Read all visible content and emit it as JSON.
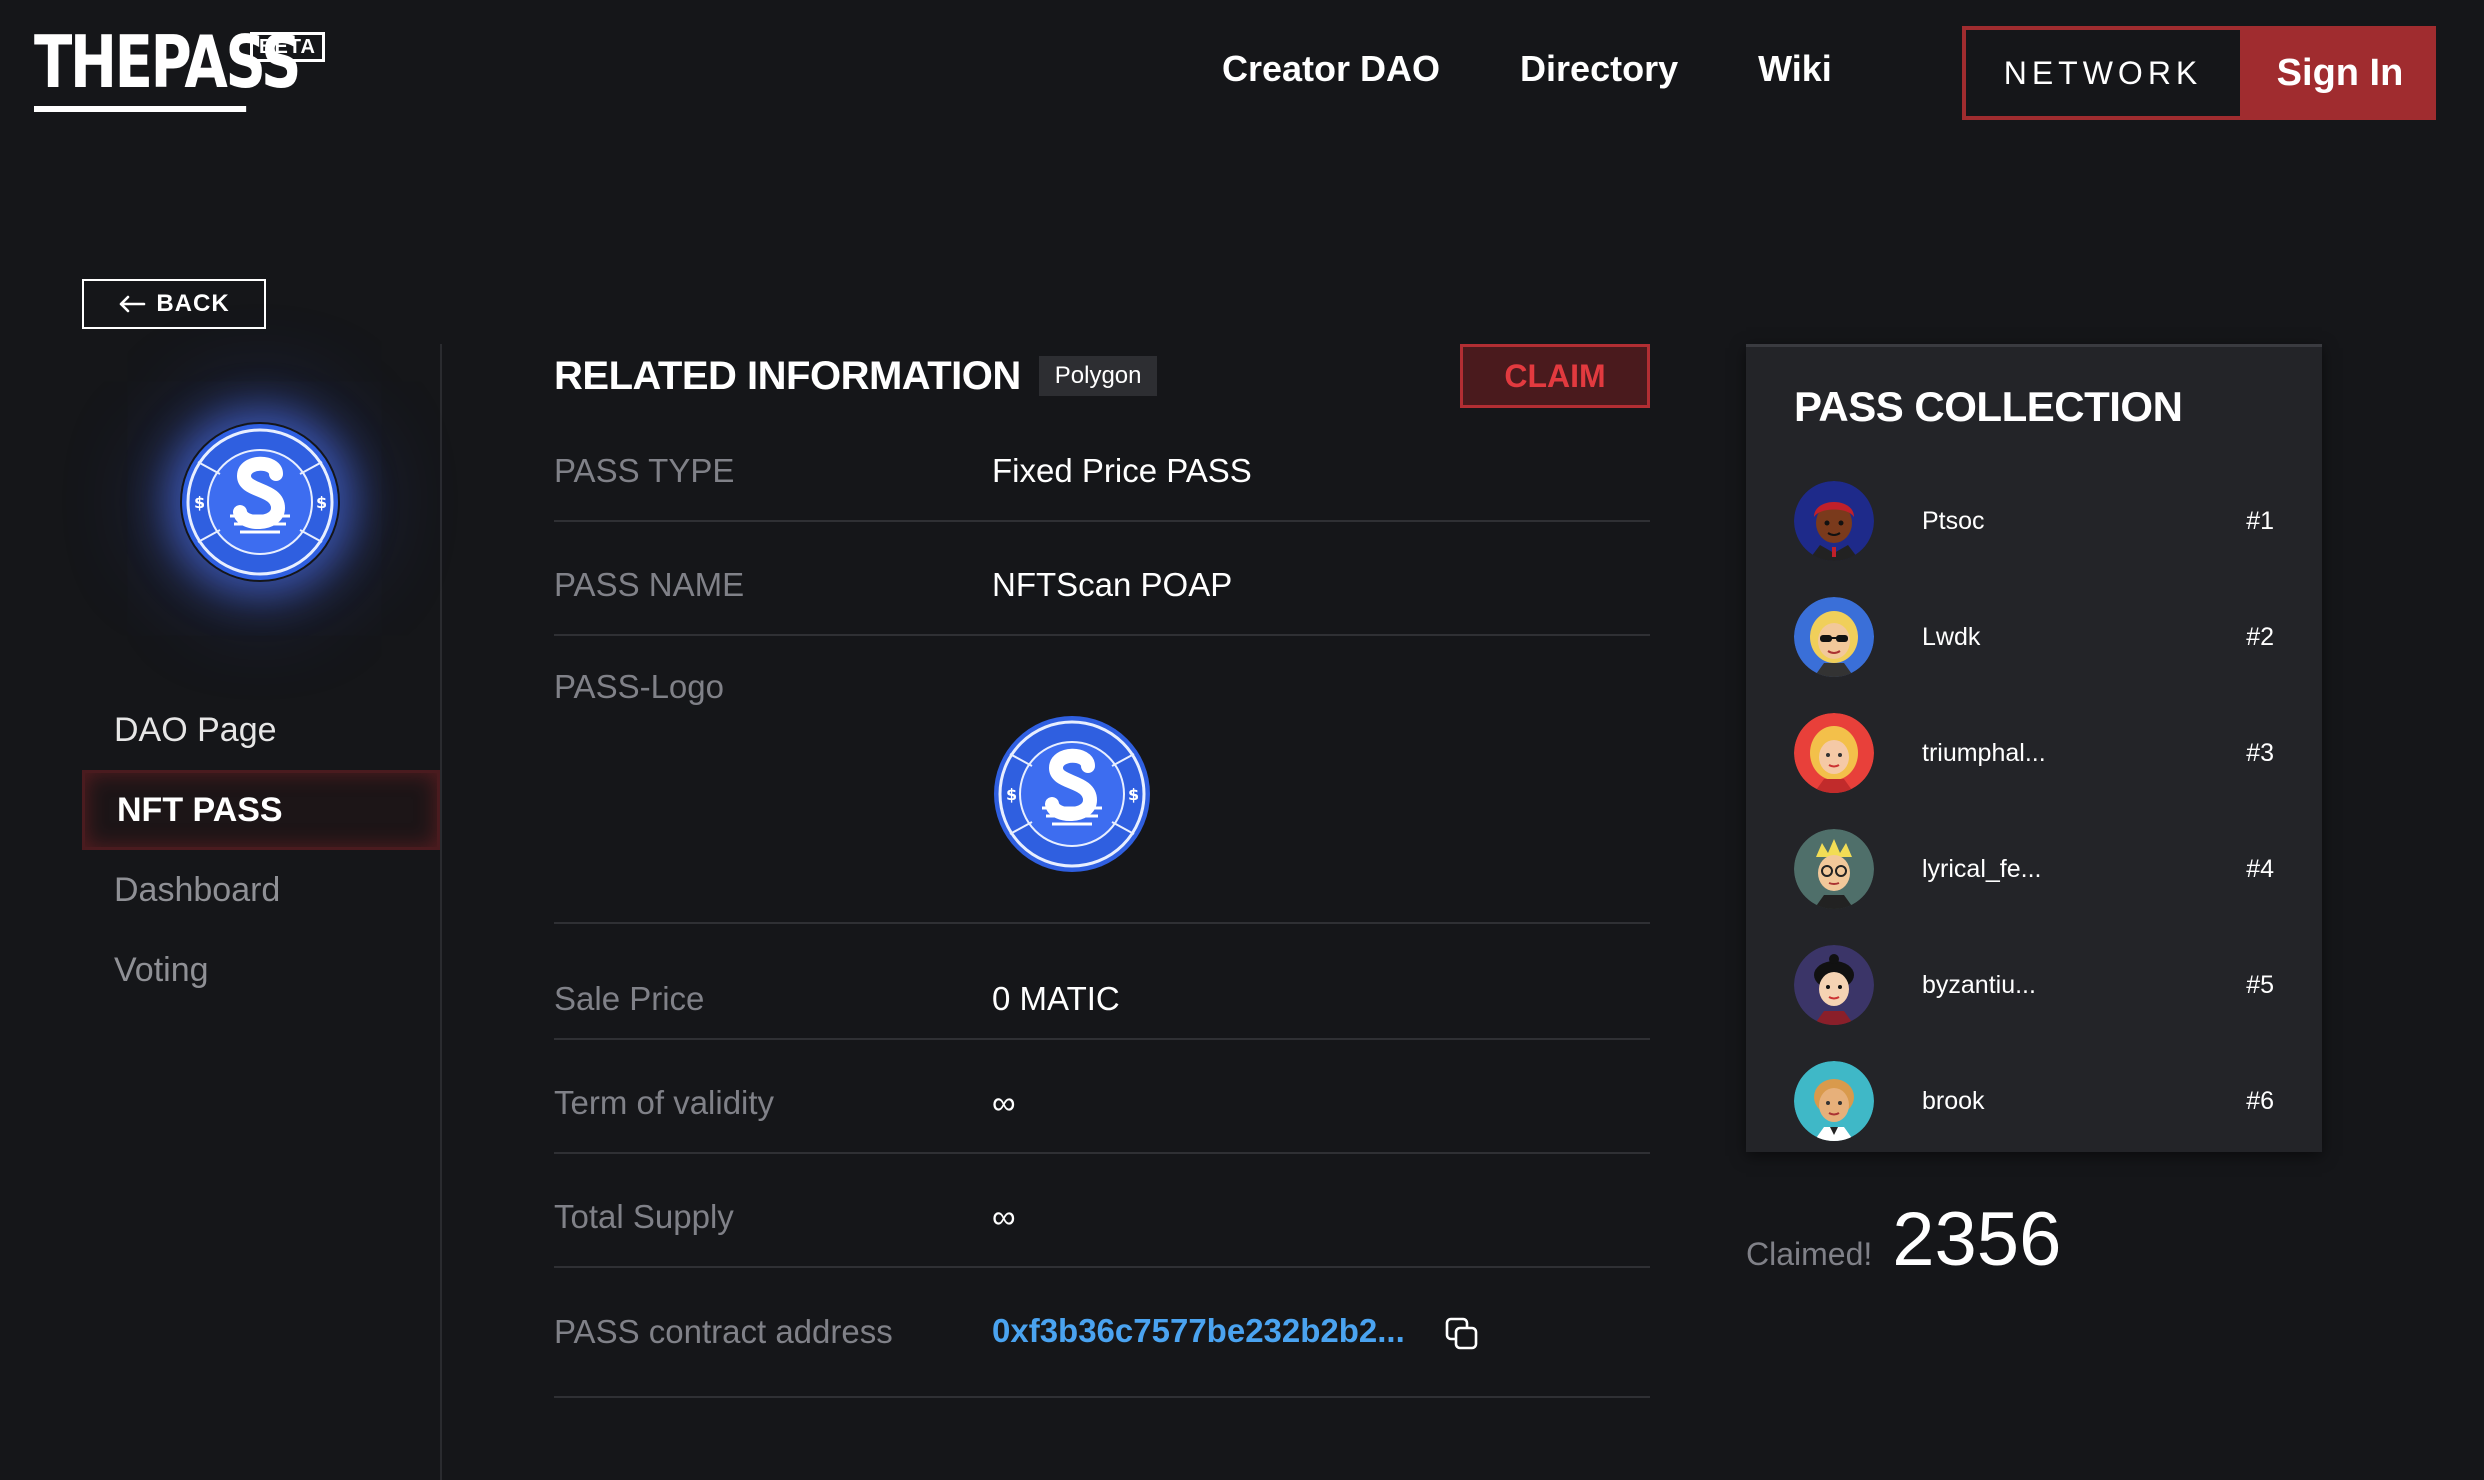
{
  "header": {
    "logo_text": "THEPASS",
    "beta_label": "BETA",
    "nav": [
      "Creator DAO",
      "Directory",
      "Wiki"
    ],
    "network_label": "NETWORK",
    "signin_label": "Sign In",
    "accent_color": "#a02c2f"
  },
  "back_label": "BACK",
  "sidebar": {
    "logo_icon": "nftscan-logo",
    "items": [
      {
        "label": "DAO Page",
        "active": false
      },
      {
        "label": "NFT PASS",
        "active": true
      },
      {
        "label": "Dashboard",
        "active": false
      },
      {
        "label": "Voting",
        "active": false
      }
    ]
  },
  "main": {
    "title": "RELATED INFORMATION",
    "chain_badge": "Polygon",
    "claim_label": "CLAIM",
    "rows": {
      "pass_type": {
        "label": "PASS TYPE",
        "value": "Fixed Price PASS"
      },
      "pass_name": {
        "label": "PASS NAME",
        "value": "NFTScan POAP"
      },
      "pass_logo": {
        "label": "PASS-Logo",
        "icon": "nftscan-logo"
      },
      "sale_price": {
        "label": "Sale Price",
        "value": "0 MATIC"
      },
      "term": {
        "label": "Term of validity",
        "value": "∞"
      },
      "supply": {
        "label": "Total Supply",
        "value": "∞"
      },
      "contract": {
        "label": "PASS contract address",
        "value": "0xf3b36c7577be232b2b2...",
        "icon": "copy-icon"
      }
    },
    "link_color": "#4aa3f0"
  },
  "collection": {
    "title": "PASS COLLECTION",
    "items": [
      {
        "name": "Ptsoc",
        "num": "#1",
        "avatar": "avatar-ptsoc"
      },
      {
        "name": "Lwdk",
        "num": "#2",
        "avatar": "avatar-lwdk"
      },
      {
        "name": "triumphal...",
        "num": "#3",
        "avatar": "avatar-triumphal"
      },
      {
        "name": "lyrical_fe...",
        "num": "#4",
        "avatar": "avatar-lyrical"
      },
      {
        "name": "byzantiu...",
        "num": "#5",
        "avatar": "avatar-byzantiu"
      },
      {
        "name": "brook",
        "num": "#6",
        "avatar": "avatar-brook"
      }
    ]
  },
  "claimed": {
    "label": "Claimed!",
    "count": "2356"
  }
}
